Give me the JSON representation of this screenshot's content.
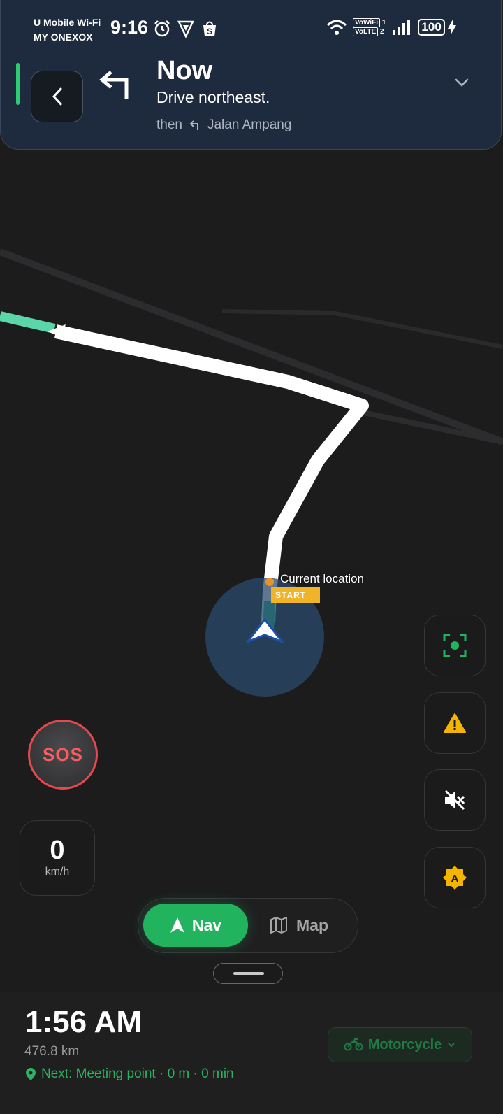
{
  "status_bar": {
    "carrier_line1": "U Mobile Wi-Fi",
    "carrier_line2": "MY ONEXOX",
    "time": "9:16",
    "battery": "100",
    "vowifi": "VoWiFi",
    "volte": "VoLTE",
    "sim1": "1",
    "sim2": "2"
  },
  "instruction": {
    "title": "Now",
    "subtitle": "Drive northeast.",
    "then_label": "then",
    "then_street": "Jalan Ampang"
  },
  "map": {
    "current_location_label": "Current location",
    "start_label": "START"
  },
  "sos": {
    "label": "SOS"
  },
  "speed": {
    "value": "0",
    "unit": "km/h"
  },
  "mode_toggle": {
    "nav_label": "Nav",
    "map_label": "Map",
    "active": "Nav"
  },
  "bottom": {
    "eta": "1:56 AM",
    "distance": "476.8 km",
    "next": "Next: Meeting point · 0 m · 0 min",
    "vehicle": "Motorcycle"
  },
  "colors": {
    "accent_green": "#22b35e",
    "sos_red": "#e5484d",
    "warning_yellow": "#f5b400",
    "header_bg": "#1e2a3d"
  }
}
